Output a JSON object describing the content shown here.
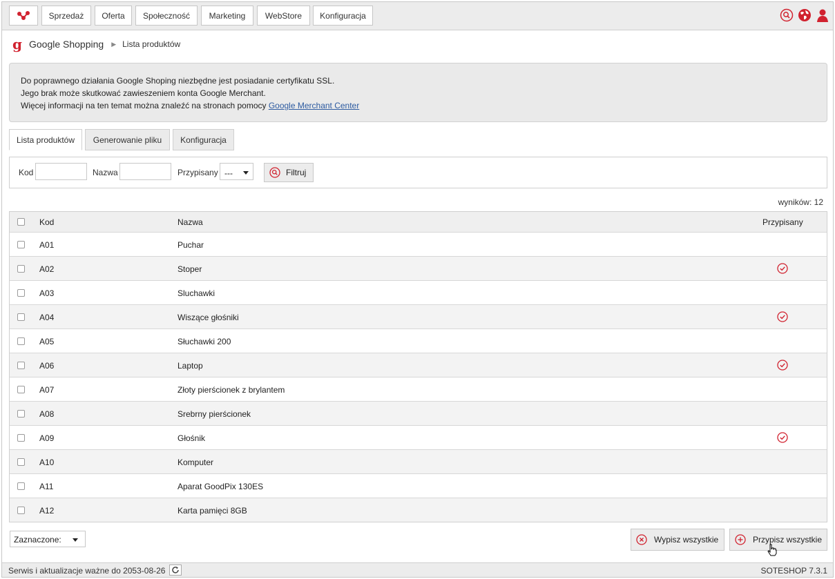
{
  "nav": {
    "items": [
      "Sprzedaż",
      "Oferta",
      "Społeczność",
      "Marketing",
      "WebStore",
      "Konfiguracja"
    ]
  },
  "breadcrumb": {
    "title": "Google Shopping",
    "current": "Lista produktów"
  },
  "info": {
    "line1": "Do poprawnego działania Google Shoping niezbędne jest posiadanie certyfikatu SSL.",
    "line2": "Jego brak może skutkować zawieszeniem konta Google Merchant.",
    "line3_text": "Więcej informacji na ten temat można znaleźć na stronach pomocy ",
    "line3_link": "Google Merchant Center"
  },
  "tabs": [
    "Lista produktów",
    "Generowanie pliku",
    "Konfiguracja"
  ],
  "filter": {
    "kod_label": "Kod",
    "kod_value": "",
    "nazwa_label": "Nazwa",
    "nazwa_value": "",
    "przypisany_label": "Przypisany",
    "przypisany_value": "---",
    "button": "Filtruj"
  },
  "results": "wyników: 12",
  "table": {
    "headers": {
      "kod": "Kod",
      "nazwa": "Nazwa",
      "przypisany": "Przypisany"
    },
    "rows": [
      {
        "kod": "A01",
        "nazwa": "Puchar",
        "assigned": false
      },
      {
        "kod": "A02",
        "nazwa": "Stoper",
        "assigned": true
      },
      {
        "kod": "A03",
        "nazwa": "Sluchawki",
        "assigned": false
      },
      {
        "kod": "A04",
        "nazwa": "Wiszące głośniki",
        "assigned": true
      },
      {
        "kod": "A05",
        "nazwa": "Słuchawki 200",
        "assigned": false
      },
      {
        "kod": "A06",
        "nazwa": "Laptop",
        "assigned": true
      },
      {
        "kod": "A07",
        "nazwa": "Złoty pierścionek z brylantem",
        "assigned": false
      },
      {
        "kod": "A08",
        "nazwa": "Srebrny pierścionek",
        "assigned": false
      },
      {
        "kod": "A09",
        "nazwa": "Głośnik",
        "assigned": true
      },
      {
        "kod": "A10",
        "nazwa": "Komputer",
        "assigned": false
      },
      {
        "kod": "A11",
        "nazwa": "Aparat GoodPix 130ES",
        "assigned": false
      },
      {
        "kod": "A12",
        "nazwa": "Karta pamięci 8GB",
        "assigned": false
      }
    ]
  },
  "bulk": {
    "selected_label": "Zaznaczone:",
    "unassign_all": "Wypisz wszystkie",
    "assign_all": "Przypisz wszystkie"
  },
  "footer": {
    "service": "Serwis i aktualizacje ważne do 2053-08-26",
    "version": "SOTESHOP 7.3.1"
  },
  "colors": {
    "accent": "#d1222f",
    "link": "#2c5aa0"
  },
  "icons": [
    "share-logo-icon",
    "search-icon",
    "globe-icon",
    "user-icon",
    "check-circle-icon",
    "close-circle-icon",
    "plus-circle-icon",
    "refresh-icon",
    "hand-cursor-icon"
  ]
}
